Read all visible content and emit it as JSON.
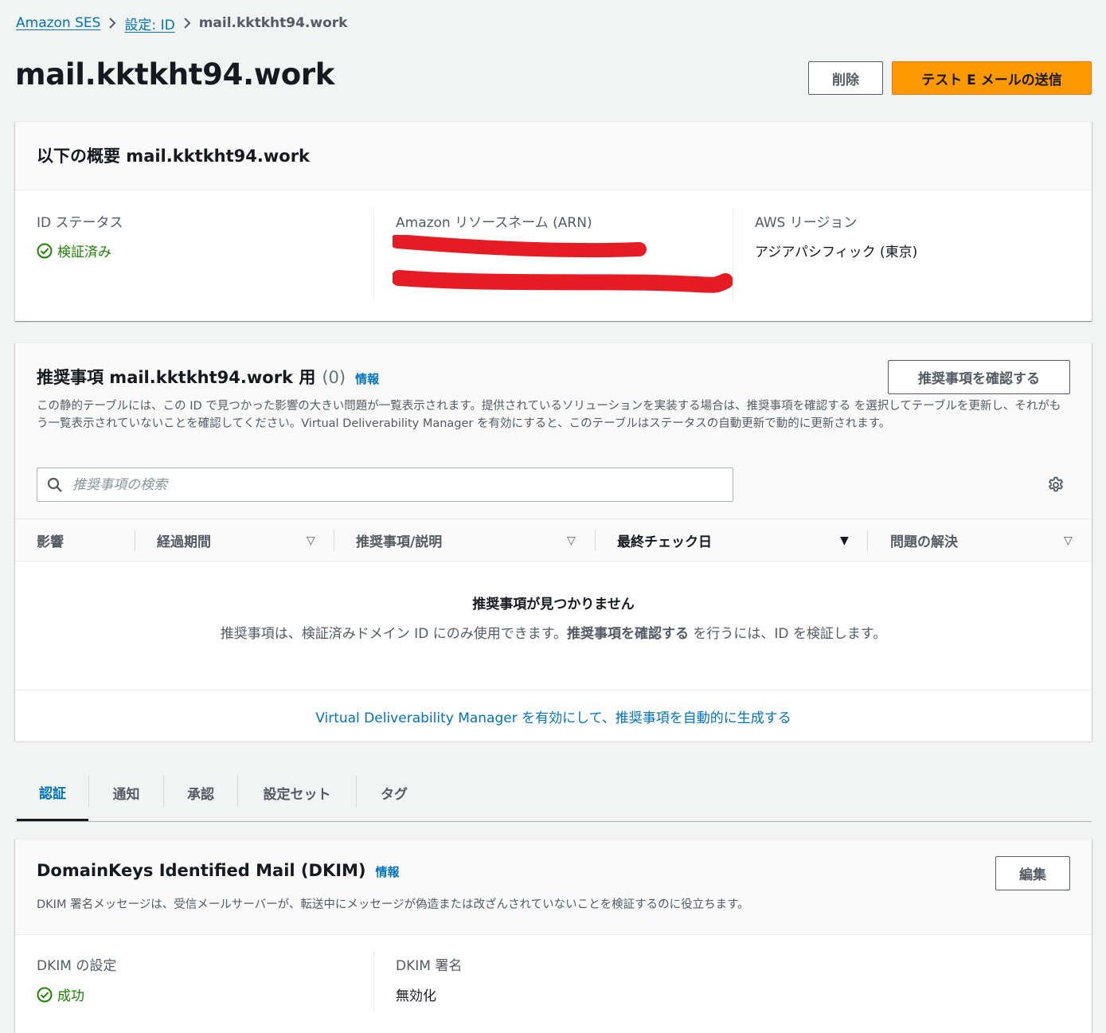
{
  "breadcrumb": {
    "items": [
      "Amazon SES",
      "設定: ID"
    ],
    "current": "mail.kktkht94.work"
  },
  "header": {
    "title": "mail.kktkht94.work",
    "delete_label": "削除",
    "send_test_label": "テスト E メールの送信"
  },
  "summary": {
    "title": "以下の概要 mail.kktkht94.work",
    "status_label": "ID ステータス",
    "status_value": "検証済み",
    "arn_label": "Amazon リソースネーム (ARN)",
    "region_label": "AWS リージョン",
    "region_value": "アジアパシフィック (東京)"
  },
  "recommendations": {
    "title": "推奨事項 mail.kktkht94.work 用",
    "count": "(0)",
    "info": "情報",
    "review_button": "推奨事項を確認する",
    "description": "この静的テーブルには、この ID で見つかった影響の大きい問題が一覧表示されます。提供されているソリューションを実装する場合は、推奨事項を確認する を選択してテーブルを更新し、それがもう一覧表示されていないことを確認してください。Virtual Deliverability Manager を有効にすると、このテーブルはステータスの自動更新で動的に更新されます。",
    "search_placeholder": "推奨事項の検索",
    "columns": [
      "影響",
      "経過期間",
      "推奨事項/説明",
      "最終チェック日",
      "問題の解決"
    ],
    "empty_title": "推奨事項が見つかりません",
    "empty_text_1": "推奨事項は、検証済みドメイン ID にのみ使用できます。",
    "empty_text_bold": "推奨事項を確認する",
    "empty_text_2": " を行うには、ID を検証します。",
    "footer_link": "Virtual Deliverability Manager を有効にして、推奨事項を自動的に生成する"
  },
  "tabs": [
    "認証",
    "通知",
    "承認",
    "設定セット",
    "タグ"
  ],
  "dkim": {
    "title": "DomainKeys Identified Mail (DKIM)",
    "info": "情報",
    "edit_button": "編集",
    "description": "DKIM 署名メッセージは、受信メールサーバーが、転送中にメッセージが偽造または改ざんされていないことを検証するのに役立ちます。",
    "config_label": "DKIM の設定",
    "config_value": "成功",
    "signing_label": "DKIM 署名",
    "signing_value": "無効化"
  },
  "colors": {
    "link": "#0073bb",
    "primary": "#ff9900",
    "success": "#1d8102",
    "redaction": "#e51c23"
  }
}
